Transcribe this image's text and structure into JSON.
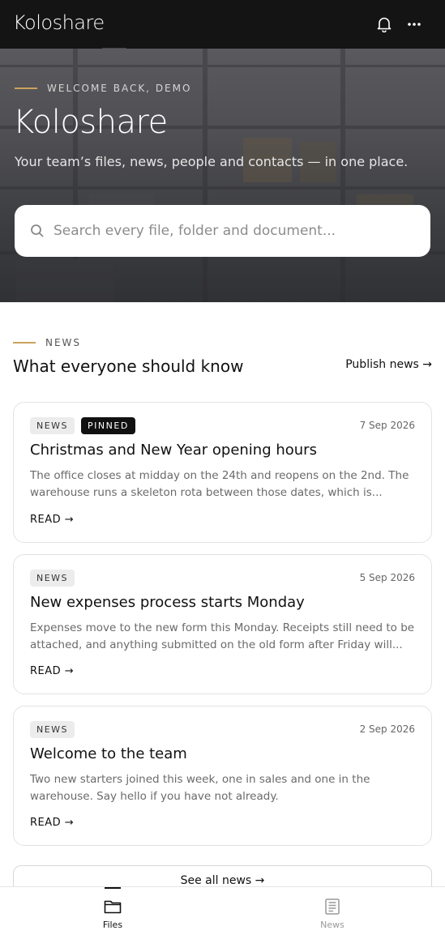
{
  "app": {
    "logo_text": "Koloshare"
  },
  "topbar": {
    "notifications_icon": "bell-icon",
    "more_icon": "ellipsis-icon"
  },
  "hero": {
    "eyebrow": "WELCOME BACK, DEMO",
    "logo_text": "Koloshare",
    "tagline": "Your team’s files, news, people and contacts — in one place.",
    "search_placeholder": "Search every file, folder and document...",
    "search_value": ""
  },
  "news_section": {
    "eyebrow": "NEWS",
    "heading": "What everyone should know",
    "publish_label": "Publish news →",
    "see_all_label": "See all news →",
    "accent_color": "#c9a35d"
  },
  "cards": [
    {
      "badge": "NEWS",
      "pinned_badge": "PINNED",
      "date": "7 Sep 2026",
      "title": "Christmas and New Year opening hours",
      "excerpt": "The office closes at midday on the 24th and reopens on the 2nd. The warehouse runs a skeleton rota between those dates, which is...",
      "read_label": "READ →"
    },
    {
      "badge": "NEWS",
      "date": "5 Sep 2026",
      "title": "New expenses process starts Monday",
      "excerpt": "Expenses move to the new form this Monday. Receipts still need to be attached, and anything submitted on the old form after Friday will...",
      "read_label": "READ →"
    },
    {
      "badge": "NEWS",
      "date": "2 Sep 2026",
      "title": "Welcome to the team",
      "excerpt": "Two new starters joined this week, one in sales and one in the warehouse. Say hello if you have not already.",
      "read_label": "READ →"
    }
  ],
  "bottom_nav": {
    "items": [
      {
        "label": "Files",
        "icon": "folder-icon",
        "active": true
      },
      {
        "label": "News",
        "icon": "newspaper-icon",
        "active": false
      }
    ]
  }
}
